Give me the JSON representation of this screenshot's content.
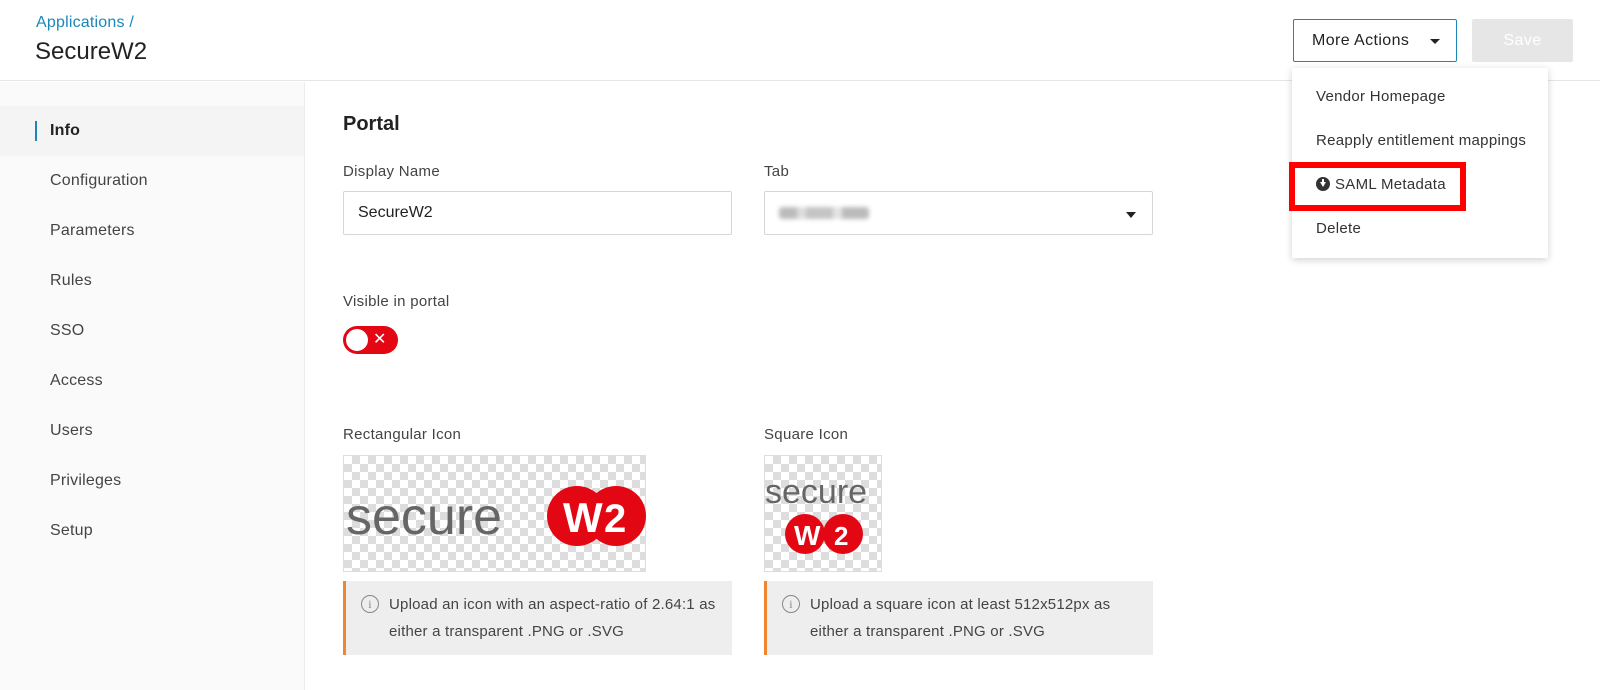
{
  "header": {
    "breadcrumb": "Applications /",
    "title": "SecureW2",
    "more_actions_label": "More Actions",
    "save_label": "Save"
  },
  "sidebar": {
    "items": [
      {
        "label": "Info",
        "active": true
      },
      {
        "label": "Configuration"
      },
      {
        "label": "Parameters"
      },
      {
        "label": "Rules"
      },
      {
        "label": "SSO"
      },
      {
        "label": "Access"
      },
      {
        "label": "Users"
      },
      {
        "label": "Privileges"
      },
      {
        "label": "Setup"
      }
    ]
  },
  "portal": {
    "section_title": "Portal",
    "display_name_label": "Display Name",
    "display_name_value": "SecureW2",
    "tab_label": "Tab",
    "visible_label": "Visible in portal",
    "visible_enabled": false,
    "rect_icon_label": "Rectangular Icon",
    "square_icon_label": "Square Icon",
    "rect_icon_hint": "Upload an icon with an aspect-ratio of 2.64:1 as either a transparent .PNG or .SVG",
    "square_icon_hint": "Upload a square icon at least 512x512px as either a transparent .PNG or .SVG",
    "logo_text": "secure",
    "logo_badge_w": "W",
    "logo_badge_2": "2"
  },
  "dropdown": {
    "items": [
      {
        "label": "Vendor Homepage"
      },
      {
        "label": "Reapply entitlement mappings"
      },
      {
        "label": "SAML Metadata",
        "icon": "download-icon",
        "highlighted": true
      },
      {
        "label": "Delete"
      }
    ]
  },
  "colors": {
    "accent": "#1a87b8",
    "toggle_off": "#e30613",
    "highlight": "#ff0000",
    "info_border": "#f0862f",
    "logo_red": "#e30613"
  }
}
